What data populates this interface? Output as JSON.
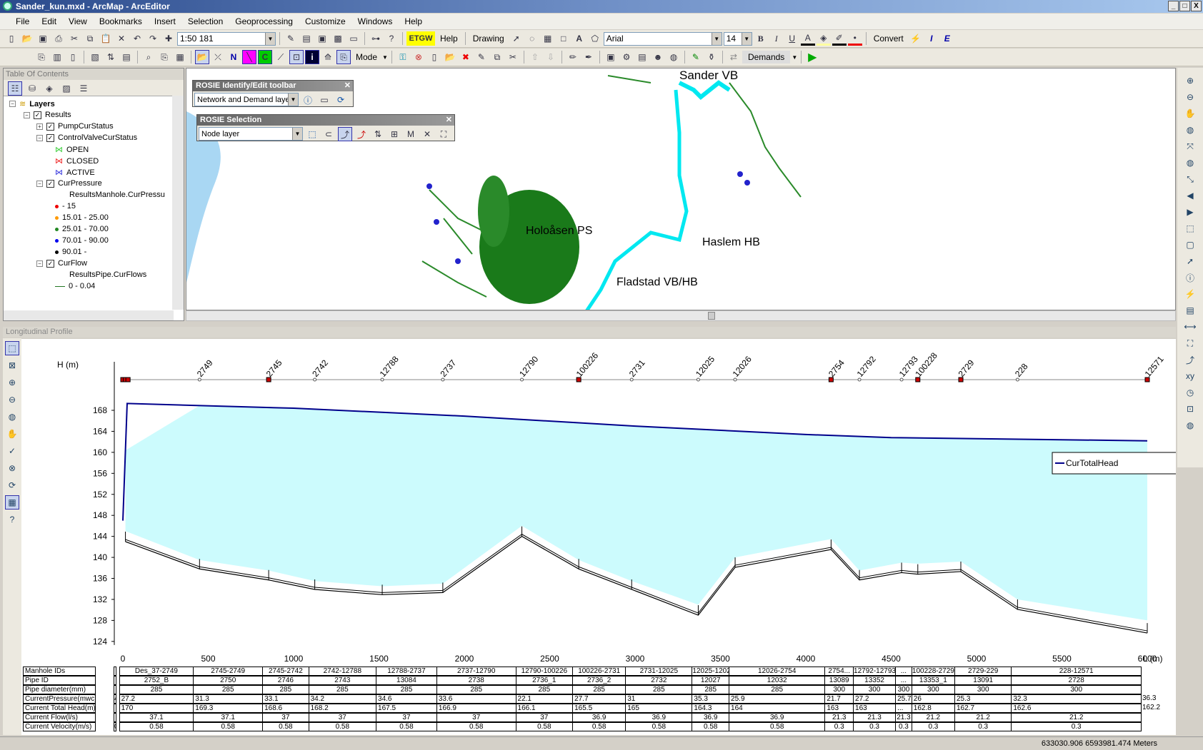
{
  "window": {
    "title": "Sander_kun.mxd - ArcMap - ArcEditor",
    "controls": [
      "_",
      "□",
      "X"
    ]
  },
  "menu": [
    "File",
    "Edit",
    "View",
    "Bookmarks",
    "Insert",
    "Selection",
    "Geoprocessing",
    "Customize",
    "Windows",
    "Help"
  ],
  "toolbar1": {
    "scale": "1:50 181",
    "help_label": "Help",
    "drawing_label": "Drawing",
    "font": "Arial",
    "font_size": "14",
    "convert_label": "Convert",
    "icons": [
      "new-icon",
      "open-icon",
      "save-icon",
      "print-icon",
      "cut-icon",
      "copy-icon",
      "paste-icon",
      "delete-icon",
      "undo-icon",
      "redo-icon",
      "add-data-icon"
    ]
  },
  "toolbar2": {
    "mode_label": "Mode",
    "demands_label": "Demands"
  },
  "toc": {
    "title": "Table Of Contents",
    "items": [
      {
        "label": "Layers",
        "level": 0,
        "kind": "root"
      },
      {
        "label": "Results",
        "level": 1,
        "kind": "group"
      },
      {
        "label": "PumpCurStatus",
        "level": 2,
        "kind": "layer",
        "collapsed": true
      },
      {
        "label": "ControlValveCurStatus",
        "level": 2,
        "kind": "layer"
      },
      {
        "label": "OPEN",
        "level": 3,
        "kind": "valve",
        "color": "#33cc33"
      },
      {
        "label": "CLOSED",
        "level": 3,
        "kind": "valve",
        "color": "#ee2222"
      },
      {
        "label": "ACTIVE",
        "level": 3,
        "kind": "valve",
        "color": "#3333dd"
      },
      {
        "label": "CurPressure",
        "level": 2,
        "kind": "layer"
      },
      {
        "label": "ResultsManhole.CurPressu",
        "level": 4,
        "kind": "field"
      },
      {
        "label": "- 15",
        "level": 3,
        "kind": "dot",
        "color": "#ee0000"
      },
      {
        "label": "15.01 - 25.00",
        "level": 3,
        "kind": "dot",
        "color": "#ff9900"
      },
      {
        "label": "25.01 - 70.00",
        "level": 3,
        "kind": "dot",
        "color": "#228822"
      },
      {
        "label": "70.01 - 90.00",
        "level": 3,
        "kind": "dot",
        "color": "#0000ee"
      },
      {
        "label": "90.01 -",
        "level": 3,
        "kind": "dot",
        "color": "#000000"
      },
      {
        "label": "CurFlow",
        "level": 2,
        "kind": "layer"
      },
      {
        "label": "ResultsPipe.CurFlows",
        "level": 4,
        "kind": "field"
      },
      {
        "label": "0 - 0.04",
        "level": 3,
        "kind": "line",
        "color": "#227722"
      }
    ]
  },
  "map": {
    "labels": [
      "Sander VB",
      "Holoåsen PS",
      "Haslem HB",
      "Fladstad VB/HB"
    ]
  },
  "rosie_identify": {
    "title": "ROSIE Identify/Edit  toolbar",
    "layer": "Network and Demand layer"
  },
  "rosie_selection": {
    "title": "ROSIE Selection",
    "layer": "Node layer"
  },
  "profile": {
    "title": "Longitudinal Profile",
    "legend": "CurTotalHead"
  },
  "chart_data": {
    "type": "line",
    "ylabel": "H (m)",
    "xlabel": "L (m)",
    "xlim": [
      0,
      6000
    ],
    "ylim": [
      124,
      170
    ],
    "xticks": [
      0,
      500,
      1000,
      1500,
      2000,
      2500,
      3000,
      3500,
      4000,
      4500,
      5000,
      5500,
      6000
    ],
    "yticks": [
      124,
      128,
      132,
      136,
      140,
      144,
      148,
      152,
      156,
      160,
      164,
      168
    ],
    "grid": false,
    "legend_position": "right",
    "colors": {
      "head": "#00008b",
      "fill": "#ccfbfd",
      "pipe": "#000000",
      "node_marker": "#cc0000"
    },
    "series": [
      {
        "name": "CurTotalHead",
        "x": [
          0,
          25,
          1000,
          2000,
          3000,
          4000,
          4500,
          5000,
          6000
        ],
        "y": [
          147,
          169.3,
          168.4,
          166.9,
          165,
          163.4,
          162.8,
          162.6,
          162.2
        ]
      }
    ],
    "pipe_profile": {
      "x": [
        15,
        449,
        854,
        1124,
        1519,
        1874,
        2337,
        2670,
        2980,
        3370,
        3586,
        4148,
        4314,
        4561,
        4656,
        4908,
        5240,
        6000
      ],
      "y": [
        143,
        137.8,
        135.7,
        133.9,
        132.9,
        133.3,
        144,
        137.8,
        133.9,
        129,
        138.1,
        141.5,
        135.7,
        137.1,
        136.8,
        137.3,
        130.1,
        125.6
      ]
    },
    "ground_profile": {
      "x": [
        15,
        449,
        854,
        1124,
        1519,
        1874,
        2337,
        2670,
        2980,
        3370,
        3586,
        4148,
        4314,
        4561,
        4656,
        4908,
        5240,
        6000
      ],
      "y": [
        145,
        139.5,
        137.5,
        135.5,
        134.5,
        135,
        146,
        139.5,
        135.5,
        131,
        140,
        143.5,
        137.5,
        139,
        138.8,
        139.2,
        132,
        128
      ]
    },
    "nodes": [
      {
        "id": "2749",
        "x": 449,
        "marker": false
      },
      {
        "id": "2745",
        "x": 854,
        "marker": true
      },
      {
        "id": "2742",
        "x": 1124,
        "marker": false
      },
      {
        "id": "12788",
        "x": 1519,
        "marker": false
      },
      {
        "id": "2737",
        "x": 1874,
        "marker": false
      },
      {
        "id": "12790",
        "x": 2337,
        "marker": false
      },
      {
        "id": "100226",
        "x": 2670,
        "marker": true
      },
      {
        "id": "2731",
        "x": 2980,
        "marker": false
      },
      {
        "id": "12025",
        "x": 3370,
        "marker": false
      },
      {
        "id": "12026",
        "x": 3586,
        "marker": false
      },
      {
        "id": "2754",
        "x": 4148,
        "marker": true
      },
      {
        "id": "12792",
        "x": 4314,
        "marker": false
      },
      {
        "id": "12793",
        "x": 4561,
        "marker": false
      },
      {
        "id": "100228",
        "x": 4656,
        "marker": true
      },
      {
        "id": "2729",
        "x": 4908,
        "marker": true
      },
      {
        "id": "228",
        "x": 5240,
        "marker": false
      },
      {
        "id": "12571",
        "x": 6000,
        "marker": true
      }
    ],
    "table": {
      "row_labels": [
        "Manhole IDs",
        "Pipe ID",
        "Pipe diameter(mm)",
        "CurrentPressure(mwc)",
        "Current Total Head(m)",
        "Current Flow(l/s)",
        "Current Velocity(m/s)"
      ],
      "segment_breaks": [
        15,
        449,
        854,
        1124,
        1519,
        1874,
        2337,
        2670,
        2980,
        3370,
        3586,
        4148,
        4314,
        4561,
        4656,
        4908,
        5240,
        6000
      ],
      "manhole_ids": [
        "Des_37-2749",
        "2745-2749",
        "2745-2742",
        "2742-12788",
        "12788-2737",
        "2737-12790",
        "12790-100226",
        "100226-2731",
        "2731-12025",
        "12025-12026",
        "12026-2754",
        "2754...",
        "12792-12793",
        "...",
        "100228-2729",
        "2729-229",
        "228-12571"
      ],
      "pipe_id": [
        "2752_B",
        "2750",
        "2746",
        "2743",
        "13084",
        "2738",
        "2736_1",
        "2736_2",
        "2732",
        "12027",
        "12032",
        "13089",
        "13352",
        "...",
        "13353_1",
        "13091",
        "2728"
      ],
      "diameter": [
        "285",
        "285",
        "285",
        "285",
        "285",
        "285",
        "285",
        "285",
        "285",
        "285",
        "285",
        "300",
        "300",
        "300",
        "300",
        "300",
        "300"
      ],
      "pressure": [
        "27.2",
        "31.3",
        "33.1",
        "34.2",
        "34.6",
        "33.6",
        "22.1",
        "27.7",
        "31",
        "35.3",
        "25.9",
        "21.7",
        "27.2",
        "25.7",
        "26",
        "25.3",
        "32.3"
      ],
      "pressure_end": "36.3",
      "pressure_first": "4",
      "total_head": [
        "170",
        "169.3",
        "168.6",
        "168.2",
        "167.5",
        "166.9",
        "166.1",
        "165.5",
        "165",
        "164.3",
        "164",
        "163",
        "163",
        "...",
        "162.8",
        "162.7",
        "162.6"
      ],
      "total_head_end": "162.2",
      "flow": [
        "37.1",
        "37.1",
        "37",
        "37",
        "37",
        "37",
        "37",
        "36.9",
        "36.9",
        "36.9",
        "36.9",
        "21.3",
        "21.3",
        "21.3",
        "21.2",
        "21.2",
        "21.2"
      ],
      "velocity": [
        "0.58",
        "0.58",
        "0.58",
        "0.58",
        "0.58",
        "0.58",
        "0.58",
        "0.58",
        "0.58",
        "0.58",
        "0.58",
        "0.3",
        "0.3",
        "0.3",
        "0.3",
        "0.3",
        "0.3"
      ],
      "velocity_first": "0"
    }
  },
  "profile_tools": [
    "select-icon",
    "zoom-extent-icon",
    "zoom-in-icon",
    "zoom-out-icon",
    "globe-icon",
    "pan-icon",
    "check-icon",
    "cancel-icon",
    "refresh-icon",
    "table-icon",
    "help-icon"
  ],
  "right_tools": [
    "zoom-in-icon",
    "zoom-out-icon",
    "pan-icon",
    "globe-icon",
    "fixed-zoom-in-icon",
    "full-extent-icon",
    "fixed-zoom-out-icon",
    "back-icon",
    "forward-icon",
    "select-features-icon",
    "clear-selection-icon",
    "pointer-icon",
    "identify-icon",
    "hyperlink-icon",
    "html-popup-icon",
    "measure-icon",
    "find-icon",
    "route-icon",
    "goto-xy-icon",
    "time-slider-icon",
    "viewer-icon",
    "globe2-icon"
  ],
  "status": {
    "coordinates": "633030.906  6593981.474 Meters"
  }
}
